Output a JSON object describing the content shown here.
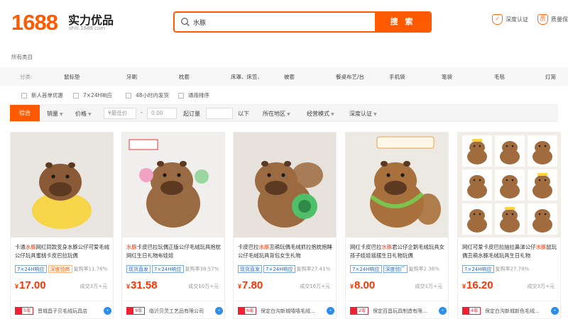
{
  "header": {
    "logo": "1688",
    "brand": "实力优品",
    "brand_url": "shili.1688.com",
    "search_value": "水豚",
    "search_button": "搜 索",
    "trust": [
      "深度认证",
      "质量保"
    ]
  },
  "all_categories": "所有类目",
  "category_bar": {
    "label": "分类:",
    "items": [
      "鼠标垫",
      "牙刷",
      "枕套",
      "床罩、床笠、",
      "被套",
      "餐桌布艺/台",
      "手机袋",
      "笔袋",
      "毛毯",
      "灯笼"
    ]
  },
  "services": [
    "新人首单优惠",
    "7×24H响应",
    "48小时内发货",
    "通用排序"
  ],
  "sortbar": {
    "active": "综合",
    "sales": "销量",
    "price": "价格",
    "min_price_placeholder": "¥最低价",
    "dash": "-",
    "max_price_placeholder": "0.00",
    "moq_label": "起订量",
    "moq_suffix": "以下",
    "region": "所在地区",
    "model": "经营模式",
    "cert": "深度认证"
  },
  "products": [
    {
      "title_pre": "卡通",
      "title_kw": "水豚",
      "title_post": "网红同款变身水豚公仔可爱毛绒公仔玩具蜜桃卡皮巴拉玩偶",
      "tags": [
        {
          "text": "7×24H响应",
          "color": "blue"
        },
        {
          "text": "深度验商",
          "color": "orange"
        }
      ],
      "rate": "复购率11.76%",
      "price": "17.00",
      "sales": "成交3万+元",
      "years": "5年",
      "shop": "晋城昌子贝毛绒玩具店",
      "palette": {
        "bg": "#e9e6e1",
        "body": "#8a5a36",
        "accent": "#f6d548"
      }
    },
    {
      "title_pre": "",
      "title_kw": "水豚",
      "title_post": "卡皮巴拉玩偶正版公仔毛绒玩具抱枕网红生日礼物布娃娃",
      "tags": [
        {
          "text": "现货直发",
          "color": "blue"
        },
        {
          "text": "7×24H响应",
          "color": "blue"
        }
      ],
      "rate": "复购率38.57%",
      "price": "31.58",
      "sales": "成交10万+元",
      "years": "9年",
      "shop": "临沂贝灵工艺品有限公司",
      "palette": {
        "bg": "#f1eeee",
        "body": "#9a6a42",
        "accent": "#f2a3c4"
      }
    },
    {
      "title_pre": "卡皮巴拉",
      "title_kw": "水豚",
      "title_post": "丑萌玩偶毛绒抓拉抱枕抱睡公仔毛绒玩具背包女生礼物",
      "tags": [
        {
          "text": "现货直发",
          "color": "blue"
        },
        {
          "text": "7×24H响应",
          "color": "blue"
        }
      ],
      "rate": "复购率27.41%",
      "price": "7.80",
      "sales": "成交16万+元",
      "years": "6年",
      "shop": "保定白沟新城嘻嘻毛绒...",
      "palette": {
        "bg": "#e7e3dc",
        "body": "#9b6a40",
        "accent": "#4fbf6a"
      }
    },
    {
      "title_pre": "网红卡皮巴拉",
      "title_kw": "水豚",
      "title_post": "君公仔企鹅毛绒玩具女孩子娃娃摇摆生日礼物玩偶",
      "tags": [
        {
          "text": "7×24H响应",
          "color": "blue"
        },
        {
          "text": "深度验厂",
          "color": "blue"
        }
      ],
      "rate": "复购率2.38%",
      "price": "8.00",
      "sales": "成交1万+元",
      "years": "2年",
      "shop": "保定百昌玩具制造有限...",
      "palette": {
        "bg": "#ece8e2",
        "body": "#a8703c",
        "accent": "#7cc44f"
      }
    },
    {
      "title_pre": "网红可爱卡皮巴拉抽拉鼻涕公仔",
      "title_kw": "水豚",
      "title_post": "鼠玩偶丑萌水豚毛绒玩具生日礼物",
      "tags": [
        {
          "text": "7×24H响应",
          "color": "blue"
        }
      ],
      "rate": "复购率27.78%",
      "price": "16.20",
      "sales": "成交3万+元",
      "years": "4年",
      "shop": "保定白沟新城新色毛绒...",
      "palette": {
        "bg": "#f2ede6",
        "body": "#a06c3e",
        "accent": "#ffd33a"
      }
    }
  ]
}
